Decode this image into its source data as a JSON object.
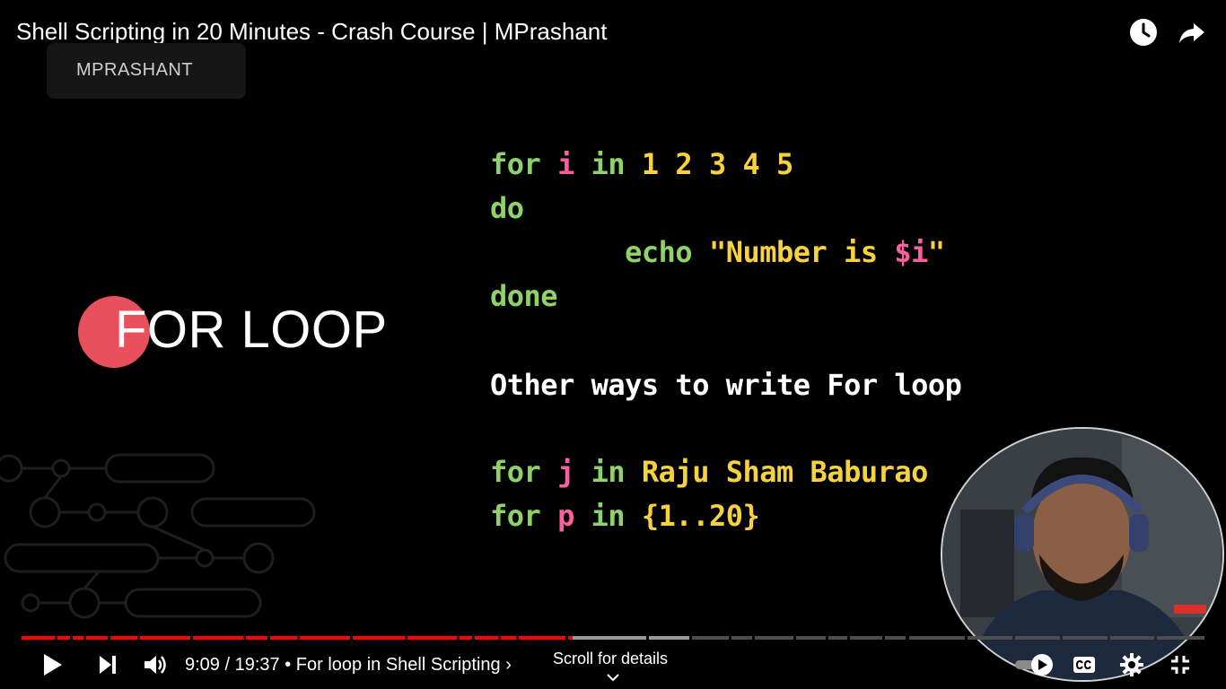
{
  "video": {
    "title": "Shell Scripting in 20 Minutes - Crash Course | MPrashant",
    "channel": "MPRASHANT"
  },
  "slide": {
    "section": "FOR LOOP",
    "code_block_1": [
      [
        {
          "t": "for",
          "c": "kw"
        },
        {
          "t": " ",
          "c": "plain"
        },
        {
          "t": "i",
          "c": "var"
        },
        {
          "t": " ",
          "c": "plain"
        },
        {
          "t": "in",
          "c": "kw"
        },
        {
          "t": " 1 2 3 4 5",
          "c": "num"
        }
      ],
      [
        {
          "t": "do",
          "c": "kw"
        }
      ],
      [
        {
          "t": "        ",
          "c": "plain"
        },
        {
          "t": "echo",
          "c": "kw"
        },
        {
          "t": " \"Number is ",
          "c": "str"
        },
        {
          "t": "$i",
          "c": "var"
        },
        {
          "t": "\"",
          "c": "str"
        }
      ],
      [
        {
          "t": "done",
          "c": "kw"
        }
      ]
    ],
    "subheading": "Other ways to write For loop",
    "code_block_2": [
      [
        {
          "t": "for",
          "c": "kw"
        },
        {
          "t": " ",
          "c": "plain"
        },
        {
          "t": "j",
          "c": "var"
        },
        {
          "t": " ",
          "c": "plain"
        },
        {
          "t": "in",
          "c": "kw"
        },
        {
          "t": " Raju Sham Baburao",
          "c": "num"
        }
      ],
      [
        {
          "t": "for",
          "c": "kw"
        },
        {
          "t": " ",
          "c": "plain"
        },
        {
          "t": "p",
          "c": "var"
        },
        {
          "t": " ",
          "c": "plain"
        },
        {
          "t": "in",
          "c": "kw"
        },
        {
          "t": " {1..20}",
          "c": "num"
        }
      ]
    ]
  },
  "player": {
    "current_time": "9:09",
    "duration": "19:37",
    "time_display": "9:09 / 19:37",
    "chapter": "• For loop in Shell Scripting",
    "chapter_chevron": "›",
    "scroll_hint": "Scroll for details",
    "played_fraction": 0.466,
    "buffered_fraction": 0.565,
    "chapter_boundaries": [
      0.0,
      0.03,
      0.043,
      0.055,
      0.075,
      0.1,
      0.145,
      0.19,
      0.21,
      0.235,
      0.28,
      0.326,
      0.37,
      0.383,
      0.405,
      0.42,
      0.462,
      0.53,
      0.567,
      0.6,
      0.62,
      0.655,
      0.682,
      0.7,
      0.73,
      0.75,
      0.8,
      0.84,
      0.88,
      0.92,
      0.96,
      1.0
    ],
    "colors": {
      "played": "#ff0000",
      "buffered": "#9a9a9a",
      "unplayed": "#4d4d4d"
    }
  },
  "icons": {
    "watch_later": "clock-icon",
    "share": "share-icon",
    "play": "play-icon",
    "next": "skip-next-icon",
    "volume": "volume-icon",
    "autoplay": "autoplay-toggle-icon",
    "captions": "captions-icon",
    "settings": "gear-icon",
    "exit_fullscreen": "exit-fullscreen-icon",
    "scroll": "chevron-down-icon"
  }
}
